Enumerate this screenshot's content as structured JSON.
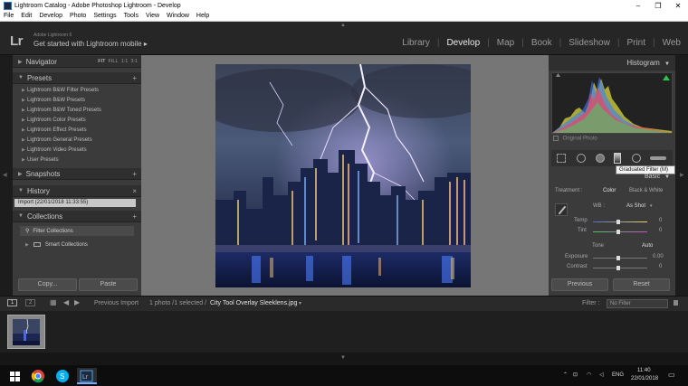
{
  "window": {
    "title": "Lightroom Catalog - Adobe Photoshop Lightroom - Develop",
    "minimize": "–",
    "maximize": "❐",
    "close": "✕"
  },
  "menu": [
    "File",
    "Edit",
    "Develop",
    "Photo",
    "Settings",
    "Tools",
    "View",
    "Window",
    "Help"
  ],
  "identity": {
    "logo": "Lr",
    "version": "Adobe Lightroom 6",
    "tagline": "Get started with Lightroom mobile",
    "tagline_arrow": "▸"
  },
  "modules": {
    "items": [
      "Library",
      "Develop",
      "Map",
      "Book",
      "Slideshow",
      "Print",
      "Web"
    ],
    "active": "Develop"
  },
  "left": {
    "navigator": {
      "title": "Navigator",
      "fit": "FIT",
      "fill": "FILL",
      "one": "1:1",
      "three": "3:1"
    },
    "presets": {
      "title": "Presets",
      "items": [
        "Lightroom B&W Filter Presets",
        "Lightroom B&W Presets",
        "Lightroom B&W Toned Presets",
        "Lightroom Color Presets",
        "Lightroom Effect Presets",
        "Lightroom General Presets",
        "Lightroom Video Presets",
        "User Presets"
      ]
    },
    "snapshots": {
      "title": "Snapshots"
    },
    "history": {
      "title": "History",
      "entry": "Import (22/01/2018 11:33:55)",
      "clear": "×"
    },
    "collections": {
      "title": "Collections",
      "filter": "Filter Collections",
      "smart": "Smart Collections"
    },
    "plus": "+",
    "copy_label": "Copy...",
    "paste_label": "Paste"
  },
  "right": {
    "histogram_title": "Histogram",
    "original_photo": "Original Photo",
    "tooltip": "Graduated Filter (M)",
    "basic_title": "Basic",
    "treatment_label": "Treatment :",
    "color_label": "Color",
    "bw_label": "Black & White",
    "wb_label": "WB :",
    "wb_value": "As Shot",
    "temp_label": "Temp",
    "temp_value": "0",
    "tint_label": "Tint",
    "tint_value": "0",
    "tone_label": "Tone",
    "auto_label": "Auto",
    "exposure_label": "Exposure",
    "exposure_value": "0.00",
    "contrast_label": "Contrast",
    "contrast_value": "0",
    "previous_label": "Previous",
    "reset_label": "Reset"
  },
  "filmbar": {
    "view1": "1",
    "view2": "2",
    "previous_import": "Previous Import",
    "count": "1 photo /1 selected /",
    "filename": "City Tool Overlay Sleeklens.jpg",
    "filter_label": "Filter :",
    "filter_value": "No Filter"
  },
  "taskbar": {
    "lang": "ENG",
    "time": "11:40",
    "date": "22/01/2018"
  },
  "colors": {
    "panel": "#3b3b3b",
    "panel_header": "#2f2f2f",
    "center_bg": "#767676",
    "active_module": "#e9e9e9"
  }
}
